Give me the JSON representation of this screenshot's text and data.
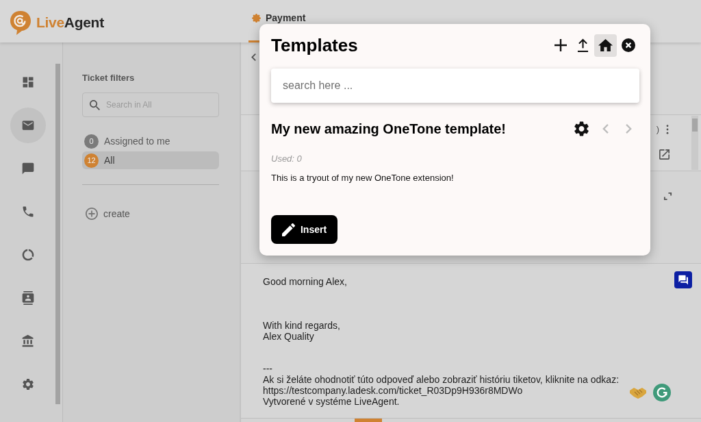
{
  "logo": {
    "prefix": "Live",
    "suffix": "Agent"
  },
  "tabs": [
    {
      "label": "Payment",
      "selected": true
    }
  ],
  "nav_rail": [
    {
      "selected": false
    },
    {
      "selected": true
    },
    {
      "selected": false
    },
    {
      "selected": false
    },
    {
      "selected": false
    },
    {
      "selected": false
    },
    {
      "selected": false
    },
    {
      "selected": false
    }
  ],
  "ticket_filters": {
    "title": "Ticket filters",
    "search": {
      "placeholder": "Search in All"
    },
    "items": [
      {
        "count": "0",
        "label": "Assigned to me",
        "color": "#7b7b7b",
        "selected": false
      },
      {
        "count": "12",
        "label": "All",
        "color": "#cf8232",
        "selected": true
      }
    ],
    "create": "create"
  },
  "ticket_row": {
    "text_fragment": ")"
  },
  "reply": {
    "paragraphs": [
      [
        "Good morning Alex,"
      ],
      [
        "With kind regards,",
        "Alex Quality"
      ],
      [
        "---",
        "Ak si želáte ohodnotiť túto odpoveď alebo zobraziť históriu tiketov, kliknite na odkaz:",
        "https://testcompany.ladesk.com/ticket_R03Dp9H936r8MDWo",
        "Vytvorené v systéme LiveAgent."
      ]
    ]
  },
  "templates_modal": {
    "title": "Templates",
    "toolbar": [
      {
        "selected": false
      },
      {
        "selected": false
      },
      {
        "selected": true
      },
      {
        "selected": false
      }
    ],
    "search": {
      "placeholder": "search here ..."
    },
    "template": {
      "name": "My new amazing OneTone template!",
      "used": "Used: 0",
      "body": "This is a tryout of my new OneTone extension!",
      "previous": {
        "disabled": true
      },
      "next": {
        "disabled": true
      }
    },
    "insert_label": "Insert"
  }
}
